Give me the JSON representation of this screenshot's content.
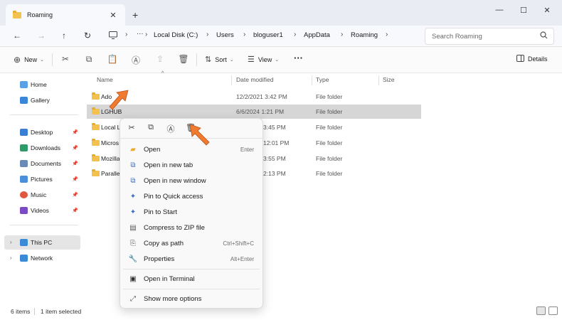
{
  "window": {
    "tab_title": "Roaming",
    "new_tab": "+",
    "close_tab": "✕",
    "min": "—",
    "max": "☐",
    "close": "✕"
  },
  "address": {
    "back": "←",
    "forward": "→",
    "up": "↑",
    "refresh": "↻",
    "more": "···",
    "crumbs": [
      "Local Disk (C:)",
      "Users",
      "bloguser1",
      "AppData",
      "Roaming"
    ],
    "search_placeholder": "Search Roaming"
  },
  "commandbar": {
    "new_label": "New",
    "sort_label": "Sort",
    "view_label": "View",
    "more": "···",
    "details_label": "Details"
  },
  "sidebar": {
    "home": "Home",
    "gallery": "Gallery",
    "desktop": "Desktop",
    "downloads": "Downloads",
    "documents": "Documents",
    "pictures": "Pictures",
    "music": "Music",
    "videos": "Videos",
    "this_pc": "This PC",
    "network": "Network"
  },
  "columns": {
    "name": "Name",
    "date": "Date modified",
    "type": "Type",
    "size": "Size"
  },
  "rows": [
    {
      "name": "Ado",
      "date": "12/2/2021 3:42 PM",
      "type": "File folder"
    },
    {
      "name": "LGHUB",
      "date": "6/6/2024 1:21 PM",
      "type": "File folder"
    },
    {
      "name": "Local L",
      "date": "3:45 PM",
      "type": "File folder"
    },
    {
      "name": "Micros",
      "date": "12:01 PM",
      "type": "File folder"
    },
    {
      "name": "Mozilla",
      "date": "3:55 PM",
      "type": "File folder"
    },
    {
      "name": "Parallel",
      "date": "2:13 PM",
      "type": "File folder"
    }
  ],
  "status": {
    "items": "6 items",
    "selected": "1 item selected"
  },
  "context_menu": {
    "items": [
      {
        "label": "Open",
        "key": "Enter"
      },
      {
        "label": "Open in new tab",
        "key": ""
      },
      {
        "label": "Open in new window",
        "key": ""
      },
      {
        "label": "Pin to Quick access",
        "key": ""
      },
      {
        "label": "Pin to Start",
        "key": ""
      },
      {
        "label": "Compress to ZIP file",
        "key": ""
      },
      {
        "label": "Copy as path",
        "key": "Ctrl+Shift+C"
      },
      {
        "label": "Properties",
        "key": "Alt+Enter"
      },
      {
        "label": "Open in Terminal",
        "key": ""
      },
      {
        "label": "Show more options",
        "key": ""
      }
    ]
  },
  "colors": {
    "folder": "#f2c14e",
    "accent": "#3a6fc4",
    "arrow": "#f07a2f"
  }
}
